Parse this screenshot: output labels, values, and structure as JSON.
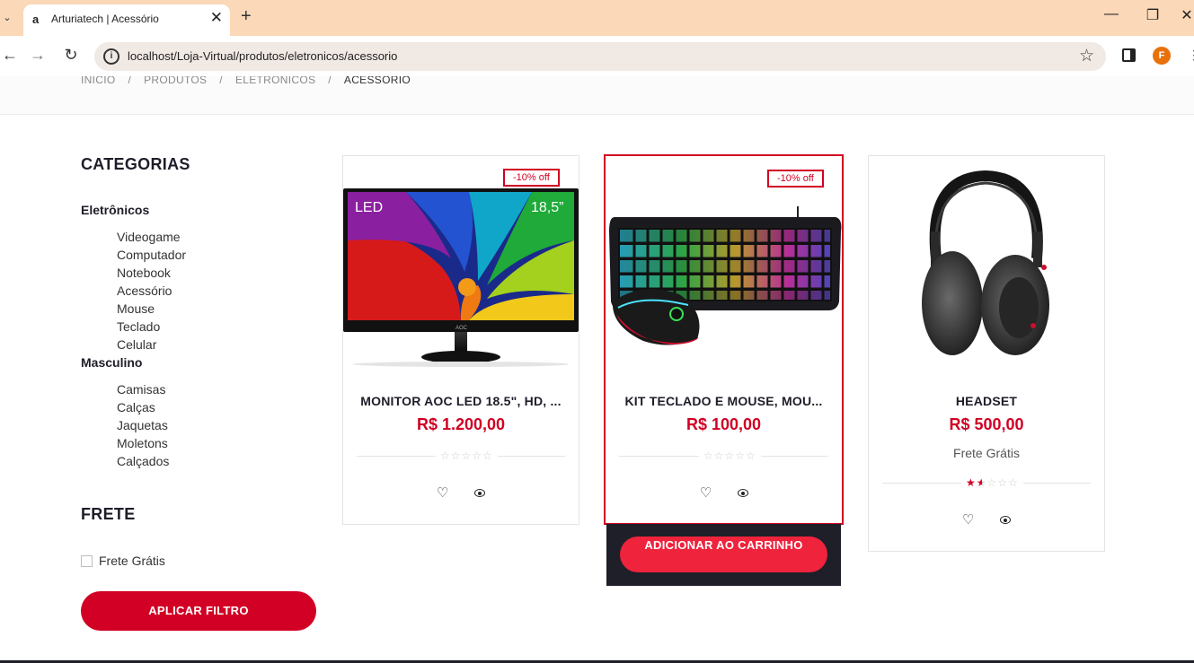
{
  "browser": {
    "tab_title": "Arturiatech | Acessório",
    "tab_favicon": "a",
    "tab_close": "✕",
    "new_tab": "+",
    "url": "localhost/Loja-Virtual/produtos/eletronicos/acessorio",
    "profile_initial": "F",
    "icons": [
      "tab-list-icon",
      "close-icon",
      "plus-icon",
      "minimize-icon",
      "restore-icon",
      "window-close-icon",
      "back-icon",
      "forward-icon",
      "reload-icon",
      "site-info-icon",
      "bookmark-star-icon",
      "side-panel-icon",
      "profile-icon",
      "menu-icon"
    ]
  },
  "breadcrumb": {
    "items": [
      "INÍCIO",
      "PRODUTOS",
      "ELETRÔNICOS",
      "ACESSÓRIO"
    ],
    "separator": "/"
  },
  "sidebar": {
    "categories_title": "CATEGORIAS",
    "groups": [
      {
        "label": "Eletrônicos",
        "items": [
          "Videogame",
          "Computador",
          "Notebook",
          "Acessório",
          "Mouse",
          "Teclado",
          "Celular"
        ]
      },
      {
        "label": "Masculino",
        "items": [
          "Camisas",
          "Calças",
          "Jaquetas",
          "Moletons",
          "Calçados"
        ]
      }
    ],
    "shipping_title": "FRETE",
    "free_shipping_label": "Frete Grátis",
    "free_shipping_checked": false,
    "apply_label": "APLICAR FILTRO"
  },
  "products": [
    {
      "name": "MONITOR AOC LED 18.5\", HD, ...",
      "price": "R$ 1.200,00",
      "badge": "-10% off",
      "shipping": "",
      "rating": 0,
      "image": "monitor-image",
      "screen_labels": [
        "LED",
        "18,5”"
      ],
      "brand": "AOC"
    },
    {
      "name": "KIT TECLADO E MOUSE, MOU...",
      "price": "R$ 100,00",
      "badge": "-10% off",
      "shipping": "",
      "rating": 0,
      "image": "keyboard-mouse-image",
      "hovered": true
    },
    {
      "name": "HEADSET",
      "price": "R$ 500,00",
      "badge": "",
      "shipping": "Frete Grátis",
      "rating": 1.5,
      "image": "headset-image"
    }
  ],
  "add_to_cart_label": "ADICIONAR AO CARRINHO",
  "colors": {
    "accent": "#d10024",
    "button": "#ef233c",
    "dark": "#1e1f29",
    "tabbar": "#fbd8b8"
  }
}
